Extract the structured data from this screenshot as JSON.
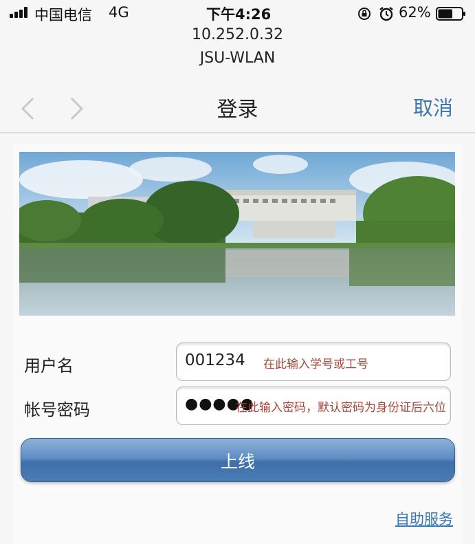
{
  "status_bar": {
    "carrier": "中国电信",
    "network": "4G",
    "time": "下午4:26",
    "battery_percent": "62%",
    "battery_level": 0.62,
    "icons": [
      "signal-icon",
      "orientation-lock-icon",
      "alarm-icon",
      "battery-icon"
    ]
  },
  "browser": {
    "address": "10.252.0.32",
    "ssid": "JSU-WLAN"
  },
  "nav": {
    "title": "登录",
    "cancel_label": "取消",
    "back_icon": "chevron-left-icon",
    "forward_icon": "chevron-right-icon"
  },
  "form": {
    "username_label": "用户名",
    "username_value": "001234",
    "username_hint": "在此输入学号或工号",
    "password_label": "帐号密码",
    "password_mask": "●●●●●",
    "password_hint": "在此输入密码，默认密码为身份证后六位",
    "submit_label": "上线"
  },
  "footer": {
    "self_service_label": "自助服务"
  },
  "colors": {
    "link": "#3b76b6",
    "hint": "#a8483a",
    "button": "#4c7cb5"
  }
}
